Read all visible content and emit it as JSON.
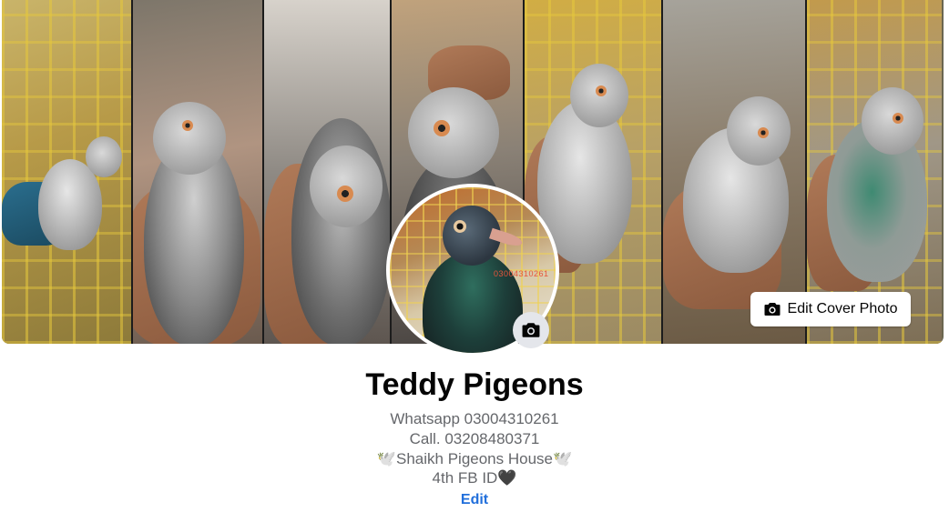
{
  "cover": {
    "edit_cover_label": "Edit Cover Photo",
    "camera_icon": "camera-icon"
  },
  "profile": {
    "avatar_watermark": "03004310261",
    "avatar_camera_icon": "camera-icon",
    "name": "Teddy Pigeons",
    "bio": {
      "line1": "Whatsapp 03004310261",
      "line2": "Call. 03208480371",
      "line3": "🕊️Shaikh Pigeons House🕊️",
      "line4": "4th FB ID🖤"
    },
    "edit_label": "Edit"
  },
  "colors": {
    "link": "#216fdb",
    "text_primary": "#050505",
    "text_secondary": "#65676b",
    "button_bg": "#e4e6eb"
  }
}
